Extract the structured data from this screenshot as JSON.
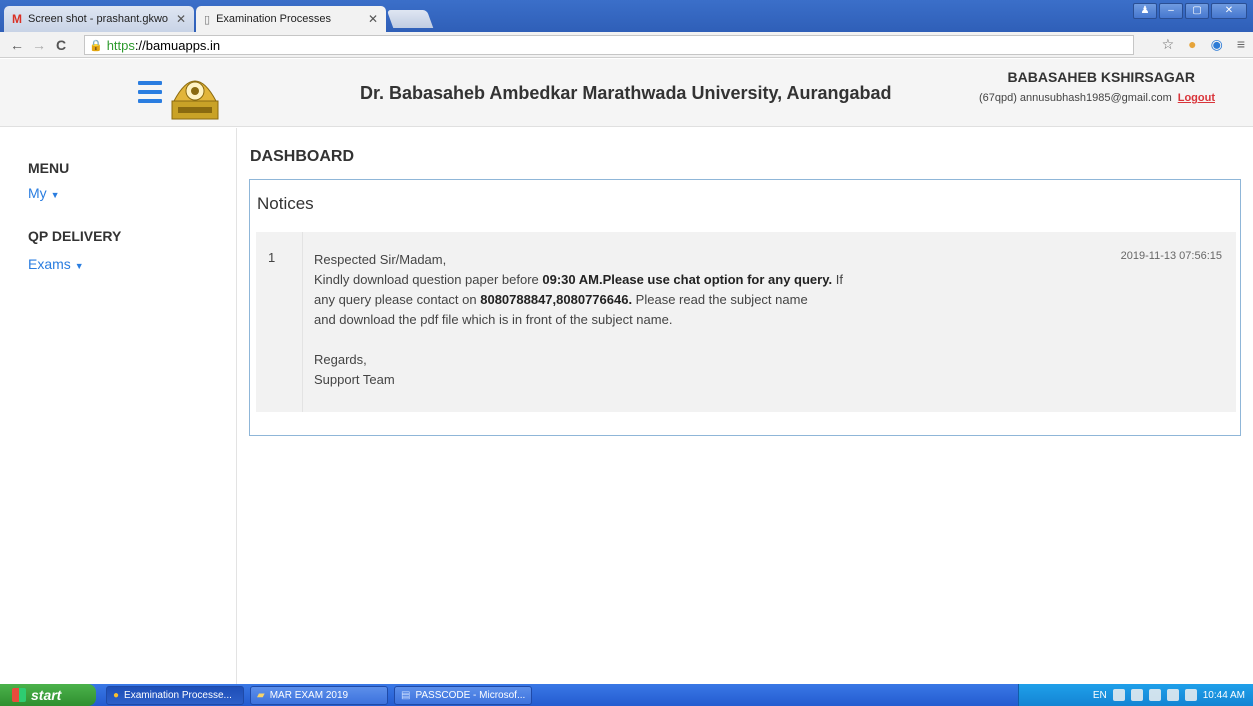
{
  "browser": {
    "tabs": [
      {
        "title": "Screen shot - prashant.gkwo",
        "active": false
      },
      {
        "title": "Examination Processes",
        "active": true
      }
    ],
    "url_protocol": "https",
    "url_rest": "://bamuapps.in"
  },
  "header": {
    "university": "Dr. Babasaheb Ambedkar Marathwada University, Aurangabad",
    "user_name": "BABASAHEB KSHIRSAGAR",
    "user_email": "(67qpd) annusubhash1985@gmail.com",
    "logout_label": "Logout"
  },
  "sidebar": {
    "menu_heading": "MENU",
    "my_label": "My",
    "qp_heading": "QP DELIVERY",
    "exams_label": "Exams"
  },
  "main": {
    "title": "DASHBOARD",
    "panel_title": "Notices",
    "notice": {
      "number": "1",
      "greeting": "Respected Sir/Madam,",
      "line1_a": "Kindly download question paper before ",
      "line1_b": "09:30 AM.Please use chat option for any query.",
      "line1_c": " If",
      "line2_a": "any query please contact on ",
      "line2_b": "8080788847,8080776646.",
      "line2_c": " Please read the subject name",
      "line3": "and download the pdf file which is in front of the subject name.",
      "regards": "Regards,",
      "signature": "Support Team",
      "date": "2019-11-13 07:56:15"
    }
  },
  "taskbar": {
    "start_label": "start",
    "tasks": [
      "Examination Processe...",
      "MAR EXAM 2019",
      "PASSCODE - Microsof..."
    ],
    "lang": "EN",
    "clock": "10:44 AM"
  },
  "colors": {
    "link": "#2a7de0",
    "logout": "#d9343a",
    "panel_border": "#8fb6d8"
  }
}
